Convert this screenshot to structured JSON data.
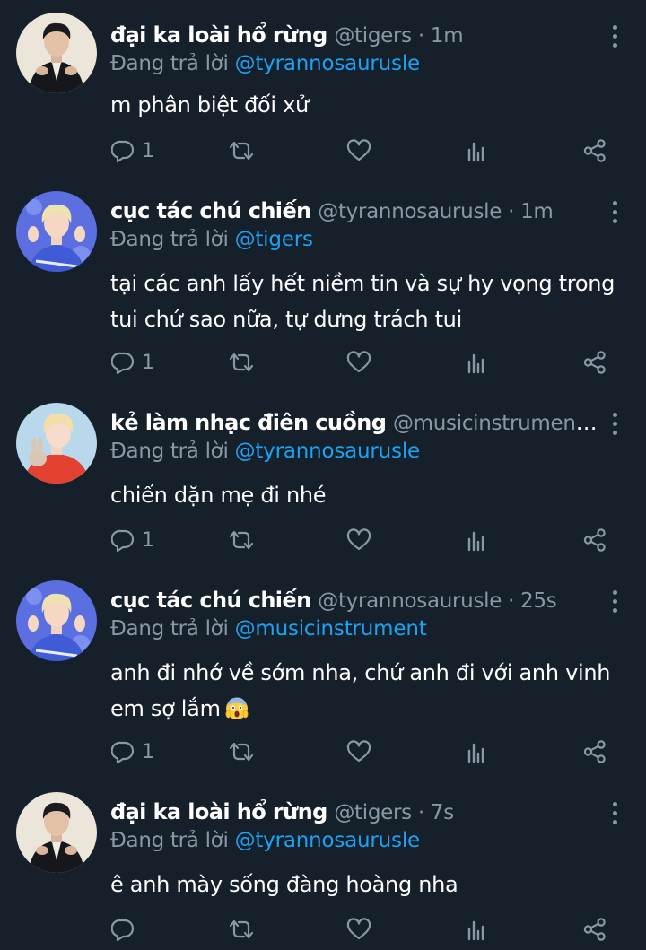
{
  "tweets": [
    {
      "display_name": "đại ka loài hổ rừng",
      "meta": "@tigers · 1m",
      "replying_label": "Đang trả lời",
      "replying_handle": "@tyrannosaurusle",
      "text": "m phân biệt đối xử",
      "reply_count": "1",
      "avatar": "man-in-black-suit-icon"
    },
    {
      "display_name": "cục tác chú chiến",
      "meta": "@tyrannosaurusle · 1m",
      "replying_label": "Đang trả lời",
      "replying_handle": "@tigers",
      "text": "tại các anh lấy hết niềm tin và sự hy vọng trong tui chứ sao nữa, tự dưng trách tui",
      "reply_count": "1",
      "avatar": "blond-man-blue-background-icon"
    },
    {
      "display_name": "kẻ làm nhạc điên cuồng",
      "meta": "@musicinstrument ...",
      "replying_label": "Đang trả lời",
      "replying_handle": "@tyrannosaurusle",
      "text": "chiến dặn mẹ đi nhé",
      "reply_count": "1",
      "avatar": "blond-man-with-rabbit-icon"
    },
    {
      "display_name": "cục tác chú chiến",
      "meta": "@tyrannosaurusle · 25s",
      "replying_label": "Đang trả lời",
      "replying_handle": "@musicinstrument",
      "text": "anh đi nhớ về sớm nha, chứ anh đi với anh vinh em sợ lắm",
      "reply_count": "1",
      "emoji": "screaming-face-emoji",
      "avatar": "blond-man-blue-background-icon"
    },
    {
      "display_name": "đại ka loài hổ rừng",
      "meta": "@tigers · 7s",
      "replying_label": "Đang trả lời",
      "replying_handle": "@tyrannosaurusle",
      "text": "ê anh mày sống đàng hoàng nha",
      "reply_count": "",
      "avatar": "man-in-black-suit-icon"
    }
  ],
  "icons": {
    "reply": "reply-bubble-icon",
    "retweet": "retweet-icon",
    "like": "heart-icon",
    "analytics": "analytics-bars-icon",
    "share": "share-icon",
    "more": "more-vertical-icon"
  },
  "colors": {
    "background": "#15202b",
    "secondary_text": "#8899a6",
    "link": "#1da1f2",
    "primary_text": "#ffffff"
  }
}
